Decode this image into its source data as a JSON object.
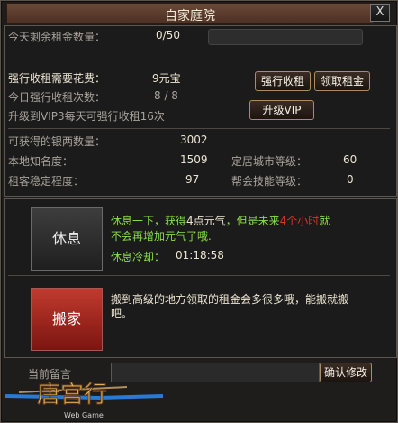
{
  "window": {
    "title": "自家庭院",
    "close_label": "X"
  },
  "rent": {
    "remaining_label": "今天剩余租金数量：",
    "remaining_value": "0/50",
    "force_cost_label": "强行收租需要花费：",
    "force_cost_value": "9元宝",
    "today_force_label": "今日强行收租次数：",
    "today_force_value": "8 / 8",
    "vip_upgrade_text": "升级到VIP3每天可强行收租16次",
    "force_collect_btn": "强行收租",
    "collect_rent_btn": "领取租金",
    "upgrade_vip_btn": "升级VIP"
  },
  "stats": {
    "silver_label": "可获得的银两数量：",
    "silver_value": "3002",
    "fame_label": "本地知名度：",
    "fame_value": "1509",
    "stability_label": "租客稳定程度：",
    "stability_value": "97",
    "city_level_label": "定居城市等级：",
    "city_level_value": "60",
    "guild_skill_label": "帮会技能等级：",
    "guild_skill_value": "0"
  },
  "rest": {
    "button": "休息",
    "desc_prefix": "休息一下，获得",
    "desc_vigor": "4点元气",
    "desc_mid": "，但是未来",
    "desc_hours": "4个小时",
    "desc_suffix": "就",
    "desc_line2": "不会再增加元气了哦.",
    "cooldown_label": "休息冷却：",
    "cooldown_value": "01:18:58"
  },
  "move": {
    "button": "搬家",
    "desc_line1": "搬到高级的地方领取的租金会多很多哦，能搬就搬",
    "desc_line2": "吧。"
  },
  "message": {
    "label": "当前留言",
    "input_value": "",
    "confirm_btn": "确认修改"
  },
  "logo": {
    "title": "唐宫行",
    "subtitle": "Web Game"
  },
  "colors": {
    "accent_green": "#88dd44",
    "accent_red": "#dd3322"
  }
}
